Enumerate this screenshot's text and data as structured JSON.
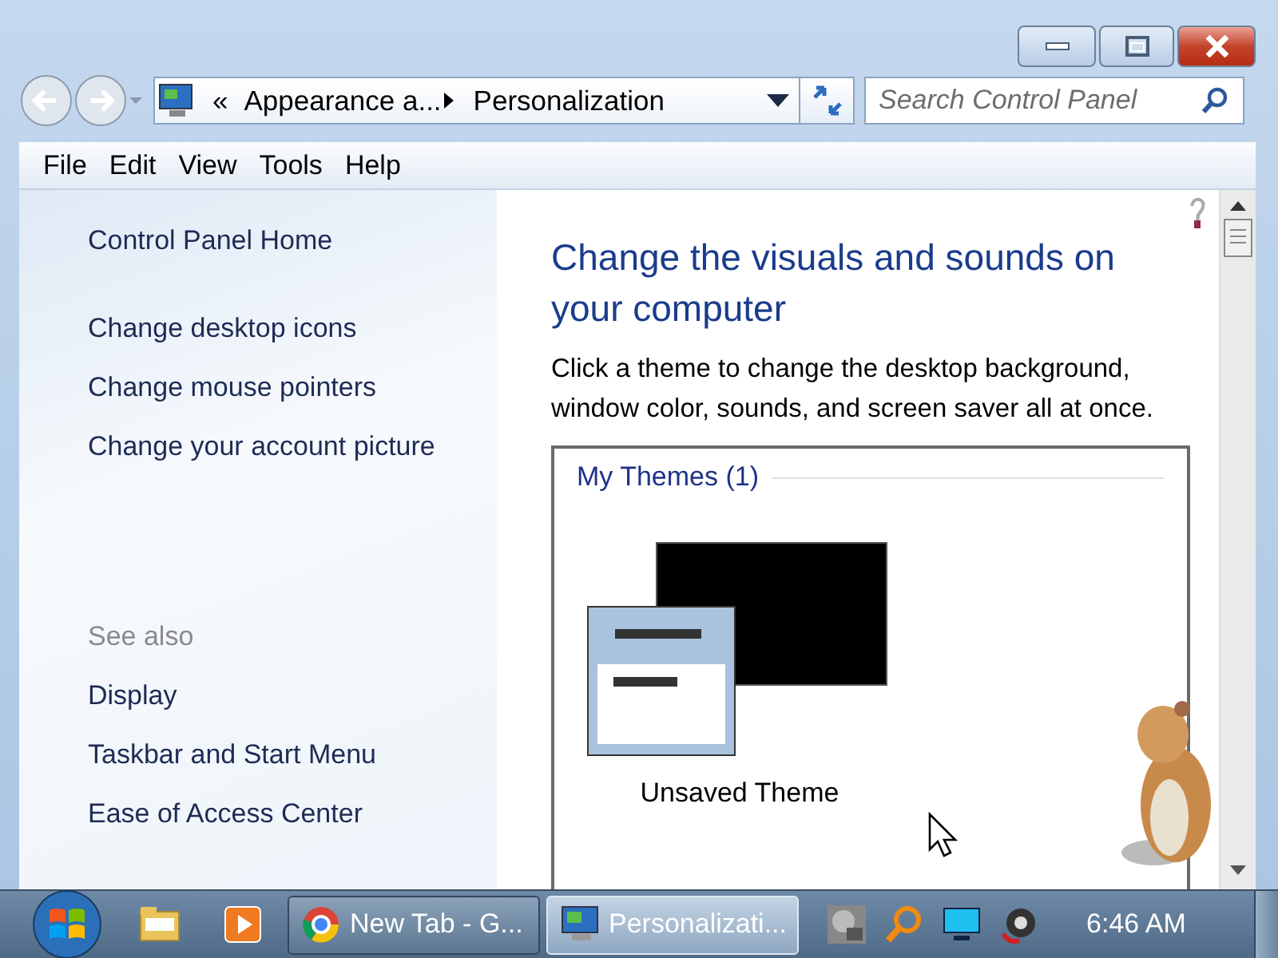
{
  "address_bar": {
    "overflow_mark": "«",
    "crumbs": [
      "Appearance a...",
      "Personalization"
    ]
  },
  "search": {
    "placeholder": "Search Control Panel"
  },
  "menu": [
    "File",
    "Edit",
    "View",
    "Tools",
    "Help"
  ],
  "sidebar": {
    "home": "Control Panel Home",
    "tasks": [
      "Change desktop icons",
      "Change mouse pointers",
      "Change your account picture"
    ],
    "see_also_heading": "See also",
    "see_also": [
      "Display",
      "Taskbar and Start Menu",
      "Ease of Access Center"
    ]
  },
  "main": {
    "heading": "Change the visuals and sounds on your computer",
    "description": "Click a theme to change the desktop background, window color, sounds, and screen saver all at once.",
    "group_title": "My Themes (1)",
    "themes": [
      {
        "name": "Unsaved Theme",
        "selected": false
      }
    ]
  },
  "taskbar": {
    "pinned": [
      {
        "kind": "folder"
      },
      {
        "kind": "media"
      }
    ],
    "tasks": [
      {
        "kind": "browser",
        "label": "New Tab - G...",
        "selected": false
      },
      {
        "kind": "control-panel",
        "label": "Personalizati...",
        "selected": true
      }
    ],
    "tray": [
      {
        "kind": "photo"
      },
      {
        "kind": "magnifier"
      },
      {
        "kind": "monitor"
      },
      {
        "kind": "speaker"
      }
    ],
    "clock": "6:46 AM"
  }
}
